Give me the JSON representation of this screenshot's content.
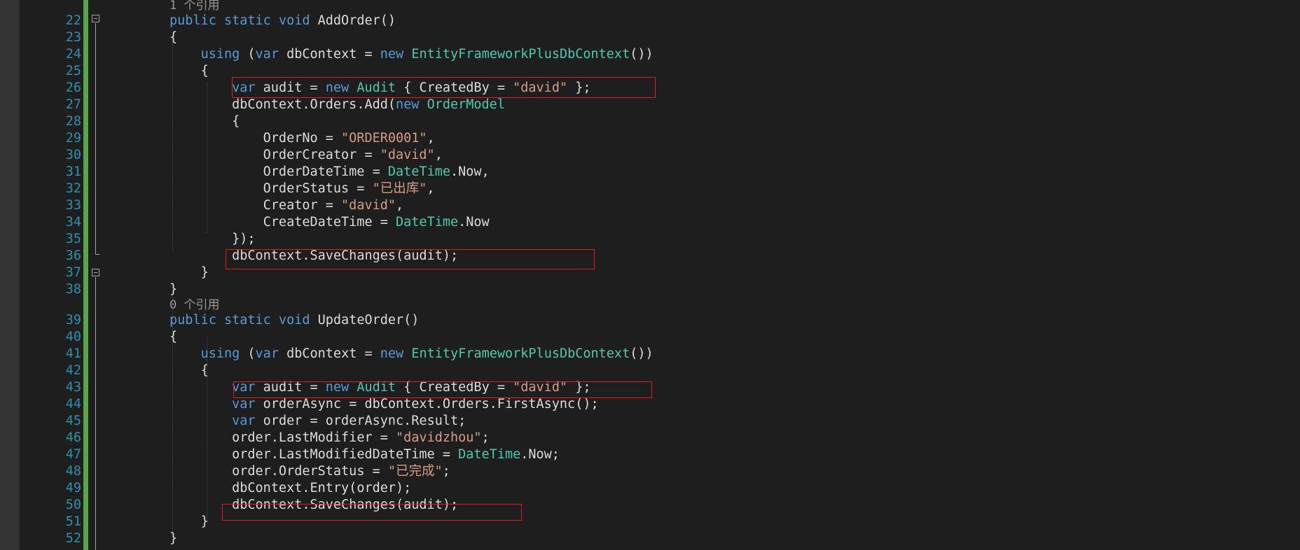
{
  "editor": {
    "codelens": {
      "add_order": "1 个引用",
      "update_order": "0 个引用"
    },
    "line_numbers": [
      "22",
      "23",
      "24",
      "25",
      "26",
      "27",
      "28",
      "29",
      "30",
      "31",
      "32",
      "33",
      "34",
      "35",
      "36",
      "37",
      "38",
      "39",
      "40",
      "41",
      "42",
      "43",
      "44",
      "45",
      "46",
      "47",
      "48",
      "49",
      "50",
      "51",
      "52"
    ],
    "code": {
      "l22": {
        "kw1": "public",
        "kw2": "static",
        "kw3": "void",
        "rest": "AddOrder()"
      },
      "l23": "{",
      "l24": {
        "kw1": "using",
        "p1": "(",
        "kw2": "var",
        "p2": "dbContext =",
        "kw3": "new",
        "ty": "EntityFrameworkPlusDbContext",
        "p3": "())"
      },
      "l25": "{",
      "l26": {
        "kw1": "var",
        "p1": "audit =",
        "kw2": "new",
        "ty": "Audit",
        "p2": "{ CreatedBy =",
        "str": "\"david\"",
        "p3": "};"
      },
      "l27": {
        "p1": "dbContext.Orders.Add(",
        "kw": "new",
        "ty": "OrderModel"
      },
      "l28": "{",
      "l29": {
        "p1": "OrderNo =",
        "str": "\"ORDER0001\"",
        "p2": ","
      },
      "l30": {
        "p1": "OrderCreator =",
        "str": "\"david\"",
        "p2": ","
      },
      "l31": {
        "p1": "OrderDateTime =",
        "ty": "DateTime",
        "p2": ".Now,"
      },
      "l32": {
        "p1": "OrderStatus =",
        "str": "\"已出库\"",
        "p2": ","
      },
      "l33": {
        "p1": "Creator =",
        "str": "\"david\"",
        "p2": ","
      },
      "l34": {
        "p1": "CreateDateTime =",
        "ty": "DateTime",
        "p2": ".Now"
      },
      "l35": "});",
      "l36": "dbContext.SaveChanges(audit);",
      "l37": "}",
      "l38": "}",
      "l39": {
        "kw1": "public",
        "kw2": "static",
        "kw3": "void",
        "rest": "UpdateOrder()"
      },
      "l40": "{",
      "l41": {
        "kw1": "using",
        "p1": "(",
        "kw2": "var",
        "p2": "dbContext =",
        "kw3": "new",
        "ty": "EntityFrameworkPlusDbContext",
        "p3": "())"
      },
      "l42": "{",
      "l43": {
        "kw1": "var",
        "p1": "audit =",
        "kw2": "new",
        "ty": "Audit",
        "p2": "{ CreatedBy =",
        "str": "\"david\"",
        "p3": "};"
      },
      "l44": {
        "kw": "var",
        "p1": "orderAsync = dbContext.Orders.FirstAsync();"
      },
      "l45": {
        "kw": "var",
        "p1": "order = orderAsync.Result;"
      },
      "l46": {
        "p1": "order.LastModifier =",
        "str": "\"davidzhou\"",
        "p2": ";"
      },
      "l47": {
        "p1": "order.LastModifiedDateTime =",
        "ty": "DateTime",
        "p2": ".Now;"
      },
      "l48": {
        "p1": "order.OrderStatus =",
        "str": "\"已完成\"",
        "p2": ";"
      },
      "l49": "dbContext.Entry(order);",
      "l50": "dbContext.SaveChanges(audit);",
      "l51": "}",
      "l52": "}"
    },
    "colors": {
      "background": "#1e1e1e",
      "keyword": "#569cd6",
      "type": "#4ec9b0",
      "string": "#d69d85",
      "line_number": "#2b91af",
      "highlight_box": "#e02020",
      "change_bar": "#57a64a"
    }
  }
}
